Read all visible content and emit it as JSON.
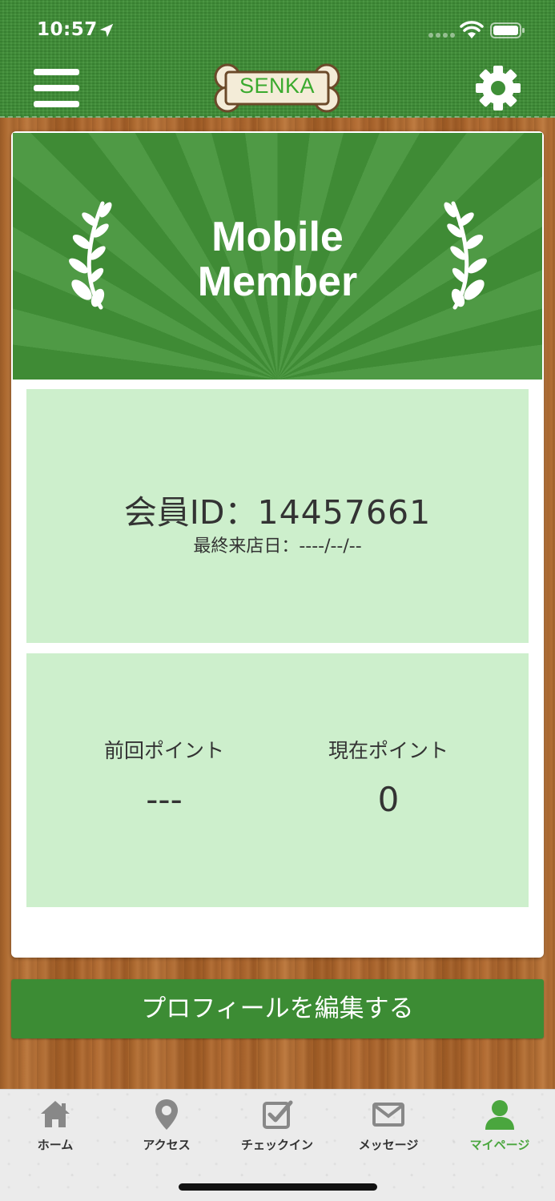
{
  "status_bar": {
    "time": "10:57"
  },
  "header": {
    "logo_text": "SENKA"
  },
  "banner": {
    "title_line1": "Mobile",
    "title_line2": "Member"
  },
  "member": {
    "id_label": "会員ID：",
    "id_value": "14457661",
    "last_visit_label": "最終来店日：",
    "last_visit_value": "----/--/--"
  },
  "points": {
    "previous_label": "前回ポイント",
    "previous_value": "---",
    "current_label": "現在ポイント",
    "current_value": "0"
  },
  "edit_profile_label": "プロフィールを編集する",
  "tabs": [
    {
      "label": "ホーム",
      "icon": "home-icon"
    },
    {
      "label": "アクセス",
      "icon": "map-pin-icon"
    },
    {
      "label": "チェックイン",
      "icon": "checkin-icon"
    },
    {
      "label": "メッセージ",
      "icon": "mail-icon"
    },
    {
      "label": "マイページ",
      "icon": "user-icon",
      "active": true
    }
  ],
  "colors": {
    "header_green": "#3f8f37",
    "banner_green": "#4f9a45",
    "panel_bg": "#cdefcc",
    "button_green": "#3c8c34",
    "active_tab": "#4aa63e"
  }
}
